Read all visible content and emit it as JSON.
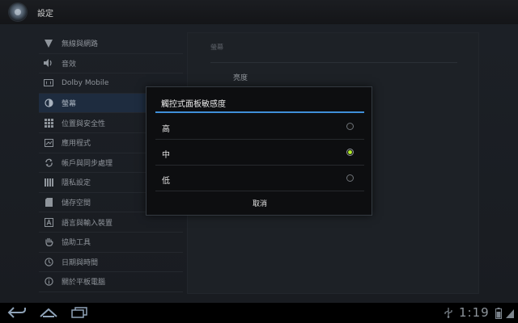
{
  "app": {
    "title": "設定"
  },
  "sidebar": {
    "items": [
      {
        "label": "無線與網路",
        "icon": "wifi-icon"
      },
      {
        "label": "音效",
        "icon": "speaker-icon"
      },
      {
        "label": "Dolby Mobile",
        "icon": "dolby-icon"
      },
      {
        "label": "螢幕",
        "icon": "brightness-icon",
        "selected": true
      },
      {
        "label": "位置與安全性",
        "icon": "grid-icon"
      },
      {
        "label": "應用程式",
        "icon": "apps-icon"
      },
      {
        "label": "帳戶與同步處理",
        "icon": "sync-icon"
      },
      {
        "label": "隱私設定",
        "icon": "privacy-icon"
      },
      {
        "label": "儲存空間",
        "icon": "storage-icon"
      },
      {
        "label": "語言與輸入裝置",
        "icon": "language-icon"
      },
      {
        "label": "協助工具",
        "icon": "hand-icon"
      },
      {
        "label": "日期與時間",
        "icon": "clock-icon"
      },
      {
        "label": "關於平板電腦",
        "icon": "info-icon"
      }
    ]
  },
  "detail": {
    "header": "螢幕",
    "item": "亮度"
  },
  "dialog": {
    "title": "觸控式面板敏感度",
    "options": [
      {
        "label": "高",
        "selected": false
      },
      {
        "label": "中",
        "selected": true
      },
      {
        "label": "低",
        "selected": false
      }
    ],
    "cancel_label": "取消"
  },
  "statusbar": {
    "time": "1:19"
  },
  "colors": {
    "accent": "#3f8fd8",
    "radio_on": "#9fd81e"
  }
}
